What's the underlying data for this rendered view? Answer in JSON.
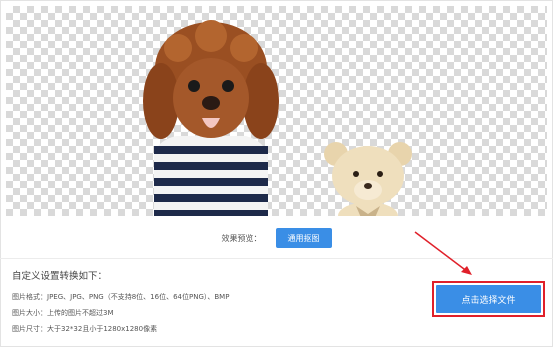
{
  "preview": {
    "effect_label": "效果预览：",
    "effect_button": "通用抠图"
  },
  "settings": {
    "title": "自定义设置转换如下：",
    "format_line": "图片格式：JPEG、JPG、PNG（不支持8位、16位、64位PNG）、BMP",
    "size_line": "图片大小：上传的图片不超过3M",
    "dimension_line": "图片尺寸：大于32*32且小于1280x1280像素"
  },
  "upload": {
    "button_label": "点击选择文件"
  },
  "colors": {
    "accent": "#3a8ee6",
    "highlight": "#e0202a"
  }
}
